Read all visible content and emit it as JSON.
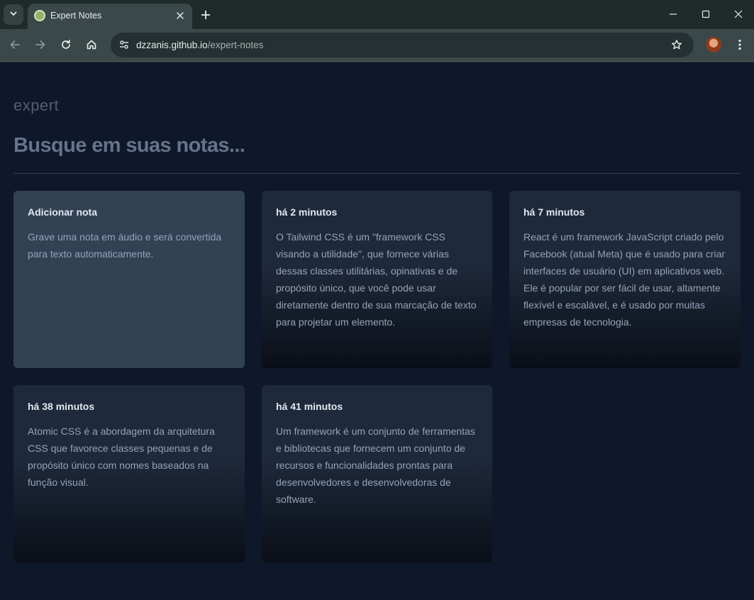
{
  "browser": {
    "tab_title": "Expert Notes",
    "url_host": "dzzanis.github.io",
    "url_path": "/expert-notes",
    "icons": {
      "tab_search": "chevron-down-icon",
      "tab_close": "close-icon",
      "new_tab": "plus-icon",
      "minimize": "minimize-icon",
      "maximize": "maximize-icon",
      "close_window": "close-icon",
      "back": "arrow-left-icon",
      "forward": "arrow-right-icon",
      "reload": "reload-icon",
      "home": "home-icon",
      "site_info": "tune-icon",
      "bookmark": "star-icon",
      "menu": "kebab-icon"
    }
  },
  "app": {
    "logo_text": "expert",
    "search_placeholder": "Busque em suas notas...",
    "add_card": {
      "title": "Adicionar nota",
      "body": "Grave uma nota em áudio e será convertida para texto automaticamente."
    },
    "notes": [
      {
        "time": "há 2 minutos",
        "content": "O Tailwind CSS é um \"framework CSS visando a utilidade\", que fornece várias dessas classes utilitárias, opinativas e de propósito único, que você pode usar diretamente dentro de sua marcação de texto para projetar um elemento."
      },
      {
        "time": "há 7 minutos",
        "content": "React é um framework JavaScript criado pelo Facebook (atual Meta) que é usado para criar interfaces de usuário (UI) em aplicativos web. Ele é popular por ser fácil de usar, altamente flexível e escalável, e é usado por muitas empresas de tecnologia."
      },
      {
        "time": "há 38 minutos",
        "content": "Atomic CSS é a abordagem da arquitetura CSS que favorece classes pequenas e de propósito único com nomes baseados na função visual."
      },
      {
        "time": "há 41 minutos",
        "content": "Um framework é um conjunto de ferramentas e bibliotecas que fornecem um conjunto de recursos e funcionalidades prontas para desenvolvedores e desenvolvedoras de software."
      }
    ]
  },
  "colors": {
    "page_bg": "#0f172a",
    "add_card_bg": "#334155",
    "note_card_bg": "#1e293b",
    "title_text": "#e2e8f0",
    "body_text": "#94a3b8",
    "placeholder": "#64748b"
  }
}
